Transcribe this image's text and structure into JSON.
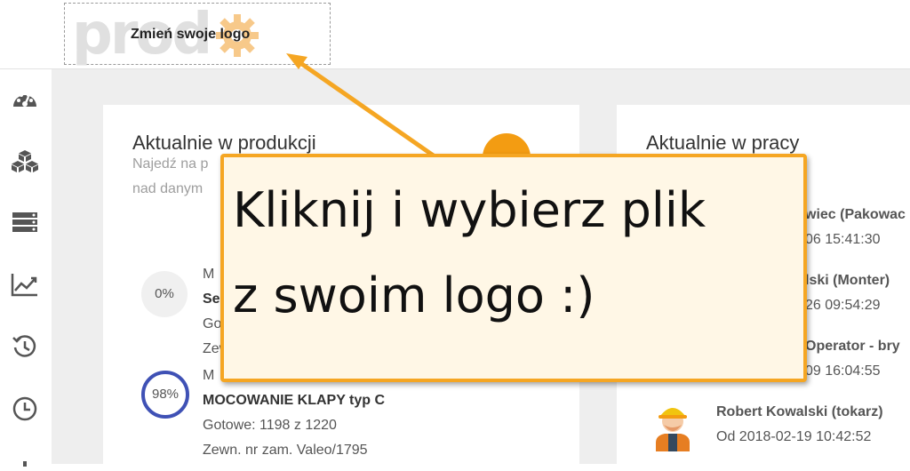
{
  "header": {
    "logo_text": "prod",
    "logo_caption": "Zmień swoje logo"
  },
  "sidebar": {
    "items": [
      {
        "icon": "dashboard-icon"
      },
      {
        "icon": "cubes-icon"
      },
      {
        "icon": "list-icon"
      },
      {
        "icon": "chart-line-icon"
      },
      {
        "icon": "history-icon"
      },
      {
        "icon": "clock-icon"
      }
    ]
  },
  "production": {
    "title": "Aktualnie w produkcji",
    "subtitle_line1": "Najedź na p",
    "subtitle_line2": "nad danym",
    "items": [
      {
        "progress_label": "0%",
        "progress": 0,
        "line1": "M",
        "line2": "Se",
        "line3": "Got",
        "line4": "Zew"
      },
      {
        "progress_label": "98%",
        "progress": 98,
        "line1": "M",
        "line2": "MOCOWANIE KLAPY typ C",
        "line3": "Gotowe: 1198 z 1220",
        "line4": "Zewn. nr zam. Valeo/1795"
      }
    ]
  },
  "work": {
    "title": "Aktualnie w pracy",
    "workers": [
      {
        "name": "wiec (Pakowac",
        "since": "06 15:41:30"
      },
      {
        "name": "lski (Monter)",
        "since": "26 09:54:29"
      },
      {
        "name": "Operator - bry",
        "since": "09 16:04:55"
      },
      {
        "name": "Robert Kowalski (tokarz)",
        "since": "Od 2018-02-19 10:42:52"
      }
    ]
  },
  "tooltip": {
    "line1": "Kliknij i wybierz plik",
    "line2": "z swoim logo :)"
  },
  "colors": {
    "accent": "#f5a623",
    "progress_ring": "#3f51b5",
    "orange": "#f39c12"
  }
}
